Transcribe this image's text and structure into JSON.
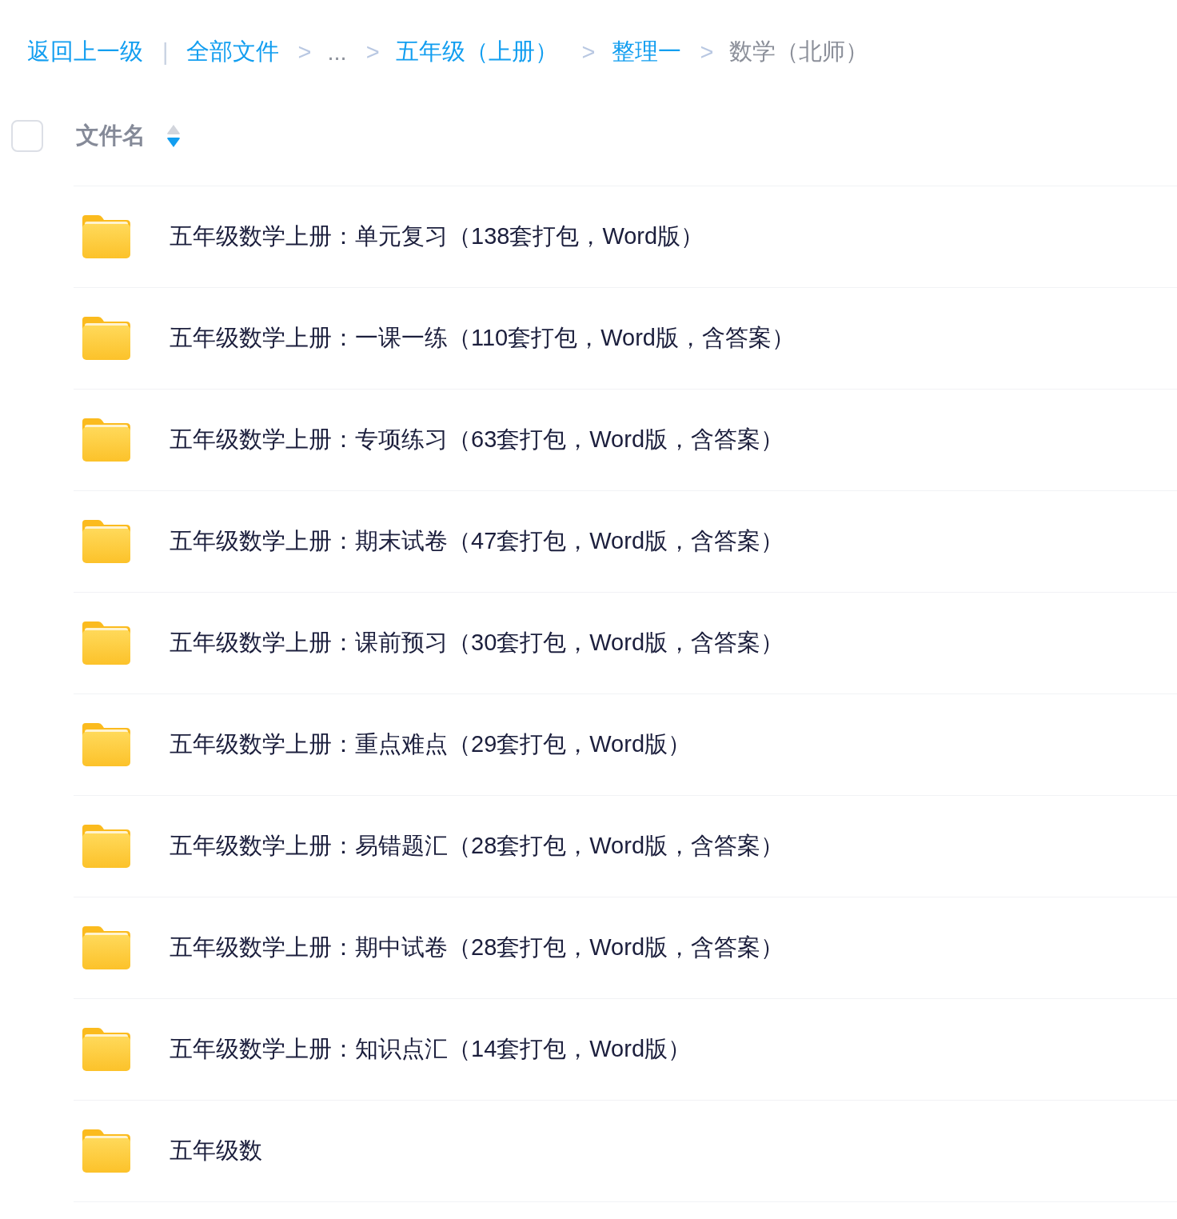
{
  "breadcrumb": {
    "back_link": "返回上一级",
    "divider": "|",
    "crumbs": [
      {
        "label": "全部文件",
        "kind": "link"
      },
      {
        "separator": ">",
        "label": "...",
        "kind": "ellipsis"
      },
      {
        "separator": ">",
        "label": "五年级（上册）",
        "kind": "link"
      },
      {
        "separator": ">",
        "label": "整理一",
        "kind": "link"
      },
      {
        "separator": ">",
        "label": "数学（北师）",
        "kind": "current"
      }
    ]
  },
  "header": {
    "select_all": {
      "checked": false
    },
    "column": "文件名",
    "sort": {
      "ascending": false,
      "descending": true
    }
  },
  "files": [
    {
      "name": "五年级数学上册：单元复习（138套打包，Word版）",
      "kind": "folder"
    },
    {
      "name": "五年级数学上册：一课一练（110套打包，Word版，含答案）",
      "kind": "folder"
    },
    {
      "name": "五年级数学上册：专项练习（63套打包，Word版，含答案）",
      "kind": "folder"
    },
    {
      "name": "五年级数学上册：期末试卷（47套打包，Word版，含答案）",
      "kind": "folder"
    },
    {
      "name": "五年级数学上册：课前预习（30套打包，Word版，含答案）",
      "kind": "folder"
    },
    {
      "name": "五年级数学上册：重点难点（29套打包，Word版）",
      "kind": "folder"
    },
    {
      "name": "五年级数学上册：易错题汇（28套打包，Word版，含答案）",
      "kind": "folder"
    },
    {
      "name": "五年级数学上册：期中试卷（28套打包，Word版，含答案）",
      "kind": "folder"
    },
    {
      "name": "五年级数学上册：知识点汇（14套打包，Word版）",
      "kind": "folder"
    },
    {
      "name": "五年级数",
      "kind": "folder"
    }
  ]
}
